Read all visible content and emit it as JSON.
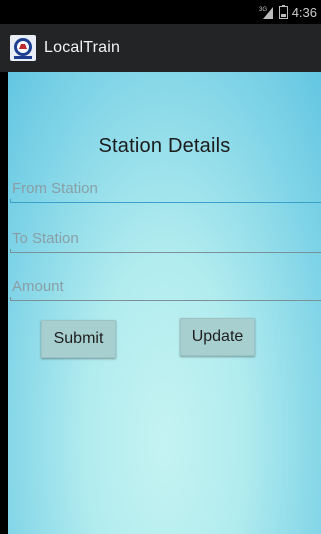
{
  "status_bar": {
    "network_label": "3G",
    "time": "4:36"
  },
  "action_bar": {
    "app_title": "LocalTrain"
  },
  "form": {
    "title": "Station Details",
    "from_station_placeholder": "From Station",
    "to_station_placeholder": "To Station",
    "amount_placeholder": "Amount",
    "submit_label": "Submit",
    "update_label": "Update"
  },
  "icons": {
    "signal": "signal-icon",
    "battery": "battery-icon",
    "app_logo": "indian-railways-logo-icon"
  },
  "colors": {
    "focus_underline": "#3a9fc9",
    "action_bar": "#222426",
    "button_bg": "#a8cfcf"
  }
}
